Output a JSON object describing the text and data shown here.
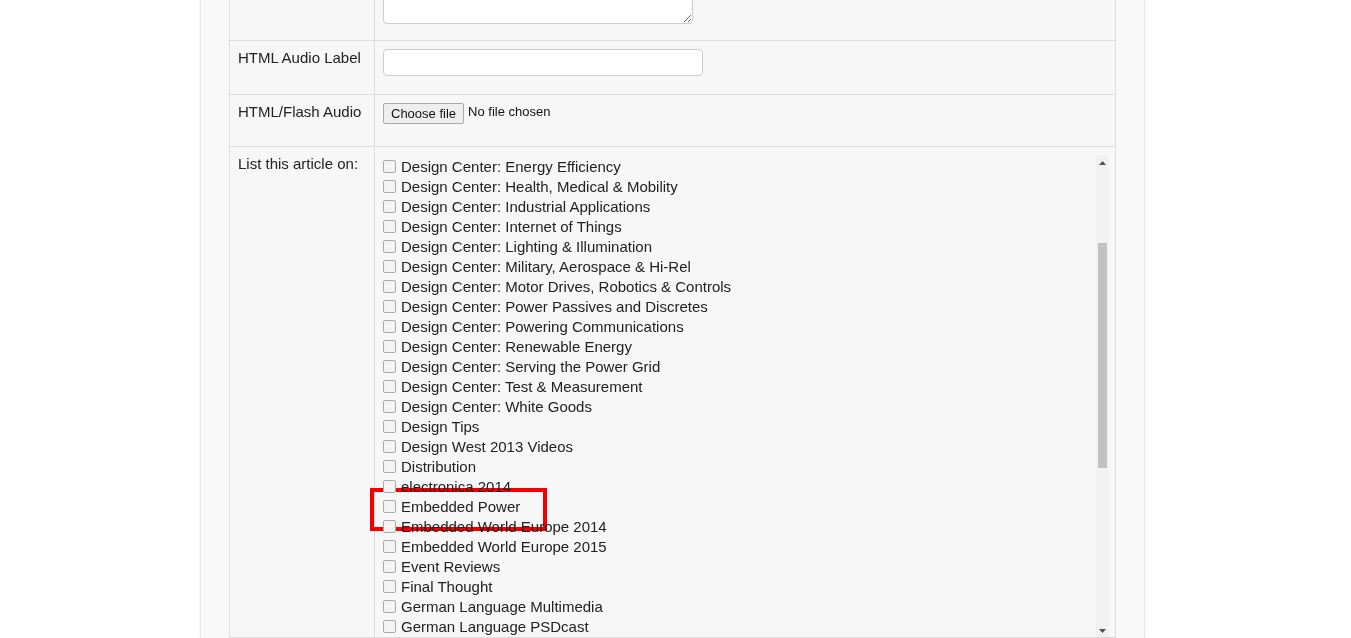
{
  "fields": [
    {
      "kind": "textarea"
    },
    {
      "kind": "text",
      "label": "HTML Audio Label"
    },
    {
      "kind": "file",
      "label": "HTML/Flash Audio",
      "button": "Choose file",
      "status": "No file chosen"
    },
    {
      "kind": "checklist",
      "label": "List this article on:",
      "options": [
        {
          "label": "Design Center: Energy Efficiency",
          "checked": false,
          "highlighted": false
        },
        {
          "label": "Design Center: Health, Medical & Mobility",
          "checked": false,
          "highlighted": false
        },
        {
          "label": "Design Center: Industrial Applications",
          "checked": false,
          "highlighted": false
        },
        {
          "label": "Design Center: Internet of Things",
          "checked": false,
          "highlighted": false
        },
        {
          "label": "Design Center: Lighting & Illumination",
          "checked": false,
          "highlighted": false
        },
        {
          "label": "Design Center: Military, Aerospace & Hi-Rel",
          "checked": false,
          "highlighted": false
        },
        {
          "label": "Design Center: Motor Drives, Robotics & Controls",
          "checked": false,
          "highlighted": false
        },
        {
          "label": "Design Center: Power Passives and Discretes",
          "checked": false,
          "highlighted": false
        },
        {
          "label": "Design Center: Powering Communications",
          "checked": false,
          "highlighted": false
        },
        {
          "label": "Design Center: Renewable Energy",
          "checked": false,
          "highlighted": false
        },
        {
          "label": "Design Center: Serving the Power Grid",
          "checked": false,
          "highlighted": false
        },
        {
          "label": "Design Center: Test & Measurement",
          "checked": false,
          "highlighted": false
        },
        {
          "label": "Design Center: White Goods",
          "checked": false,
          "highlighted": false
        },
        {
          "label": "Design Tips",
          "checked": false,
          "highlighted": false
        },
        {
          "label": "Design West 2013 Videos",
          "checked": false,
          "highlighted": false
        },
        {
          "label": "Distribution",
          "checked": false,
          "highlighted": false
        },
        {
          "label": "electronica 2014",
          "checked": false,
          "highlighted": false
        },
        {
          "label": "Embedded Power",
          "checked": false,
          "highlighted": true
        },
        {
          "label": "Embedded World Europe 2014",
          "checked": false,
          "highlighted": false
        },
        {
          "label": "Embedded World Europe 2015",
          "checked": false,
          "highlighted": false
        },
        {
          "label": "Event Reviews",
          "checked": false,
          "highlighted": false
        },
        {
          "label": "Final Thought",
          "checked": false,
          "highlighted": false
        },
        {
          "label": "German Language Multimedia",
          "checked": false,
          "highlighted": false
        },
        {
          "label": "German Language PSDcast",
          "checked": false,
          "highlighted": false
        }
      ]
    }
  ]
}
